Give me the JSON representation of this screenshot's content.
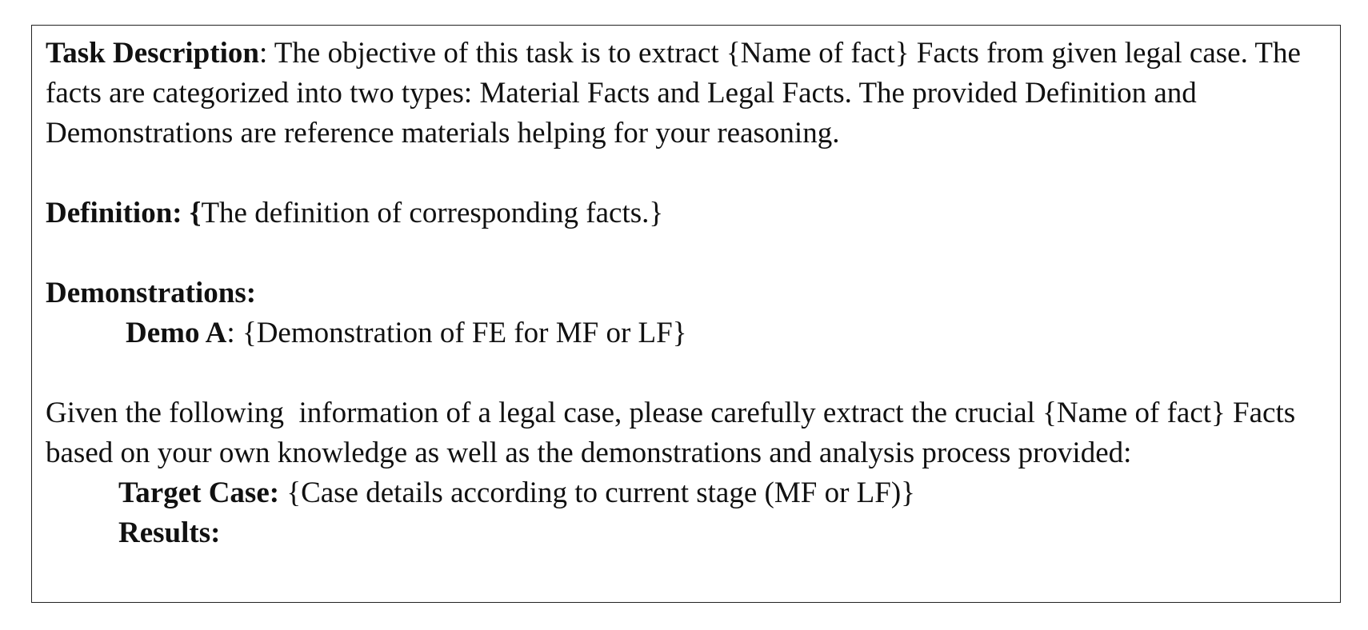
{
  "task": {
    "label": "Task Description",
    "sep": ":",
    "text": " The objective of this task is to extract {Name of fact} Facts from given legal case. The facts are categorized into two types: Material Facts and Legal Facts. The provided Definition and Demonstrations are reference materials helping for your reasoning."
  },
  "definition": {
    "label": "Definition: {",
    "text": "The definition of corresponding facts.}"
  },
  "demonstrations": {
    "label": "Demonstrations:",
    "demo_label": "Demo A",
    "demo_sep": ":",
    "demo_text": " {Demonstration of FE for MF or LF}"
  },
  "instruction": {
    "text": "Given the following  information of a legal case, please carefully extract the crucial {Name of fact} Facts based on your own knowledge as well as the demonstrations and analysis process provided:"
  },
  "target": {
    "label": "Target Case:",
    "text": " {Case details according to current stage (MF or LF)}"
  },
  "results": {
    "label": "Results:"
  }
}
